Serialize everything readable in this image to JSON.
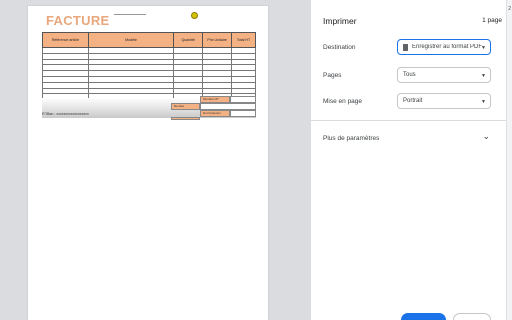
{
  "invoice": {
    "title": "FACTURE",
    "columns": [
      "Référence article",
      "Modèle",
      "Quantité",
      "Prix Unitaire",
      "Total HT"
    ],
    "bank_line": "R°IBan : xxxxxxxxxxxxxxxxxx",
    "summary_labels": [
      "Montant HT",
      "Remise",
      "Net Financier"
    ]
  },
  "print_panel": {
    "title": "Imprimer",
    "page_count": "1 page",
    "destination_label": "Destination",
    "destination_value": "Enregistrer au format PDF",
    "pages_label": "Pages",
    "pages_value": "Tous",
    "layout_label": "Mise en page",
    "layout_value": "Portrait",
    "more_settings": "Plus de paramètres"
  },
  "side_strip": {
    "number": "2"
  }
}
